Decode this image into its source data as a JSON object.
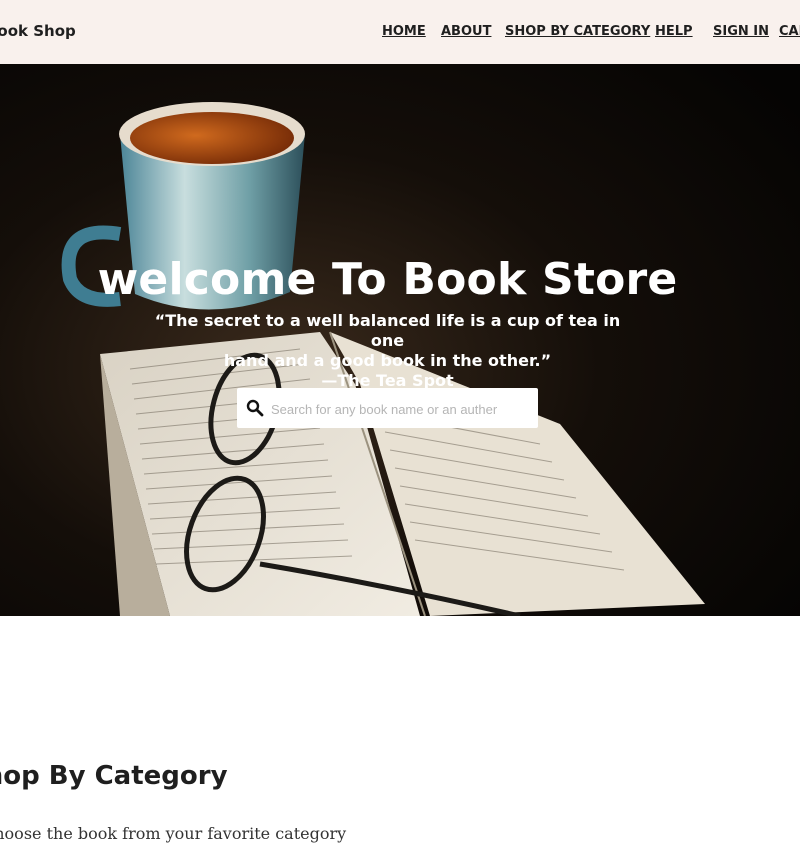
{
  "header": {
    "brand": "Book Shop",
    "nav": [
      "HOME",
      "ABOUT",
      "SHOP BY CATEGORY",
      "HELP",
      "SIGN IN",
      "CART"
    ]
  },
  "hero": {
    "title": "welcome To Book Store",
    "quote_line1": "“The secret to a well balanced life is a cup of tea in one",
    "quote_line2": "hand and a good book in the other.”",
    "quote_author": "—The Tea Spot",
    "search_placeholder": "Search for any book name or an auther"
  },
  "section": {
    "title": "Shop By Category",
    "subtitle": "Choose the book from your favorite category"
  }
}
